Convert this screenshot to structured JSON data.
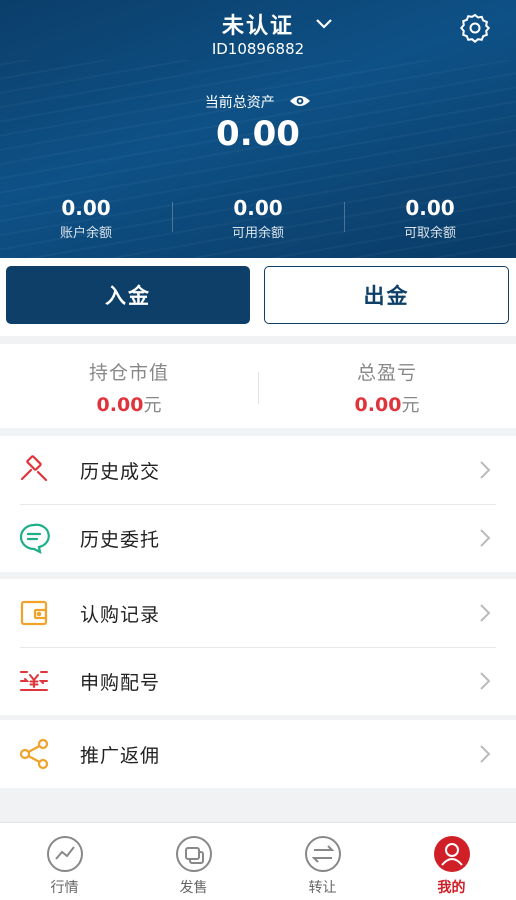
{
  "header": {
    "title": "未认证",
    "user_id": "ID10896882",
    "assets_label": "当前总资产",
    "total_assets": "0.00",
    "balances": [
      {
        "value": "0.00",
        "label": "账户余额"
      },
      {
        "value": "0.00",
        "label": "可用余额"
      },
      {
        "value": "0.00",
        "label": "可取余额"
      }
    ]
  },
  "actions": {
    "deposit": "入金",
    "withdraw": "出金"
  },
  "stats": [
    {
      "label": "持仓市值",
      "value": "0.00",
      "unit": "元"
    },
    {
      "label": "总盈亏",
      "value": "0.00",
      "unit": "元"
    }
  ],
  "menu": {
    "history_trades": "历史成交",
    "history_orders": "历史委托",
    "subscription_records": "认购记录",
    "allotment_numbers": "申购配号",
    "referral_rebate": "推广返佣"
  },
  "icons": {
    "history_trades": "gavel-icon",
    "history_orders": "chat-list-icon",
    "subscription_records": "wallet-icon",
    "allotment_numbers": "yen-transfer-icon",
    "referral_rebate": "share-icon"
  },
  "colors": {
    "header": "#0e5186",
    "primary": "#0d3f68",
    "accent_red": "#e0343c",
    "tab_active": "#d11f27"
  },
  "tabbar": [
    {
      "label": "行情",
      "active": false
    },
    {
      "label": "发售",
      "active": false
    },
    {
      "label": "转让",
      "active": false
    },
    {
      "label": "我的",
      "active": true
    }
  ]
}
